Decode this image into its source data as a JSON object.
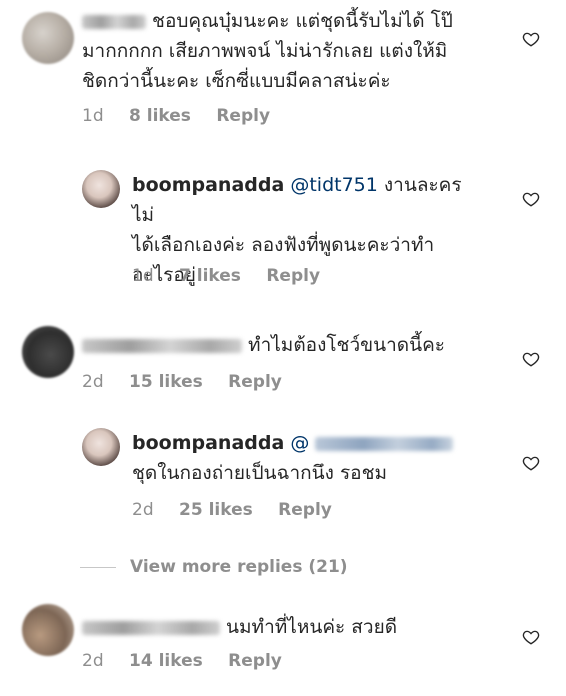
{
  "comments": [
    {
      "text_line1": "ชอบคุณบุ๋มนะคะ แต่ชุดนี้รับไม่ได้ โป๊",
      "text_line2": "มากกกกก เสียภาพพจน์ ไม่น่ารักเลย แต่งให้มิ",
      "text_line3": "ชิดกว่านี้นะคะ เซ็กซี่แบบมีคลาสน่ะค่ะ",
      "time": "1d",
      "likes": "8 likes",
      "reply": "Reply"
    },
    {
      "username": "boompanadda",
      "mention": "@tidt751",
      "text_line1": " งานละครไม่",
      "text_line2": "ได้เลือกเองค่ะ ลองฟังที่พูดนะคะว่าทำ",
      "text_line3": "อะไรอยู่",
      "time": "1d",
      "likes": "7 likes",
      "reply": "Reply"
    },
    {
      "text_line1": "ทำไมต้องโชว์ขนาดนี้คะ",
      "time": "2d",
      "likes": "15 likes",
      "reply": "Reply"
    },
    {
      "username": "boompanadda",
      "mention": "@",
      "text_line2": "ชุดในกองถ่ายเป็นฉากนึง รอชม",
      "time": "2d",
      "likes": "25 likes",
      "reply": "Reply"
    },
    {
      "text_line1": "นมทำที่ไหนค่ะ สวยดี",
      "time": "2d",
      "likes": "14 likes",
      "reply": "Reply"
    }
  ],
  "view_more": "View more replies (21)",
  "icons": {
    "like": "heart-outline-icon"
  },
  "colors": {
    "text": "#262626",
    "meta": "#8e8e8e",
    "mention": "#003569"
  }
}
